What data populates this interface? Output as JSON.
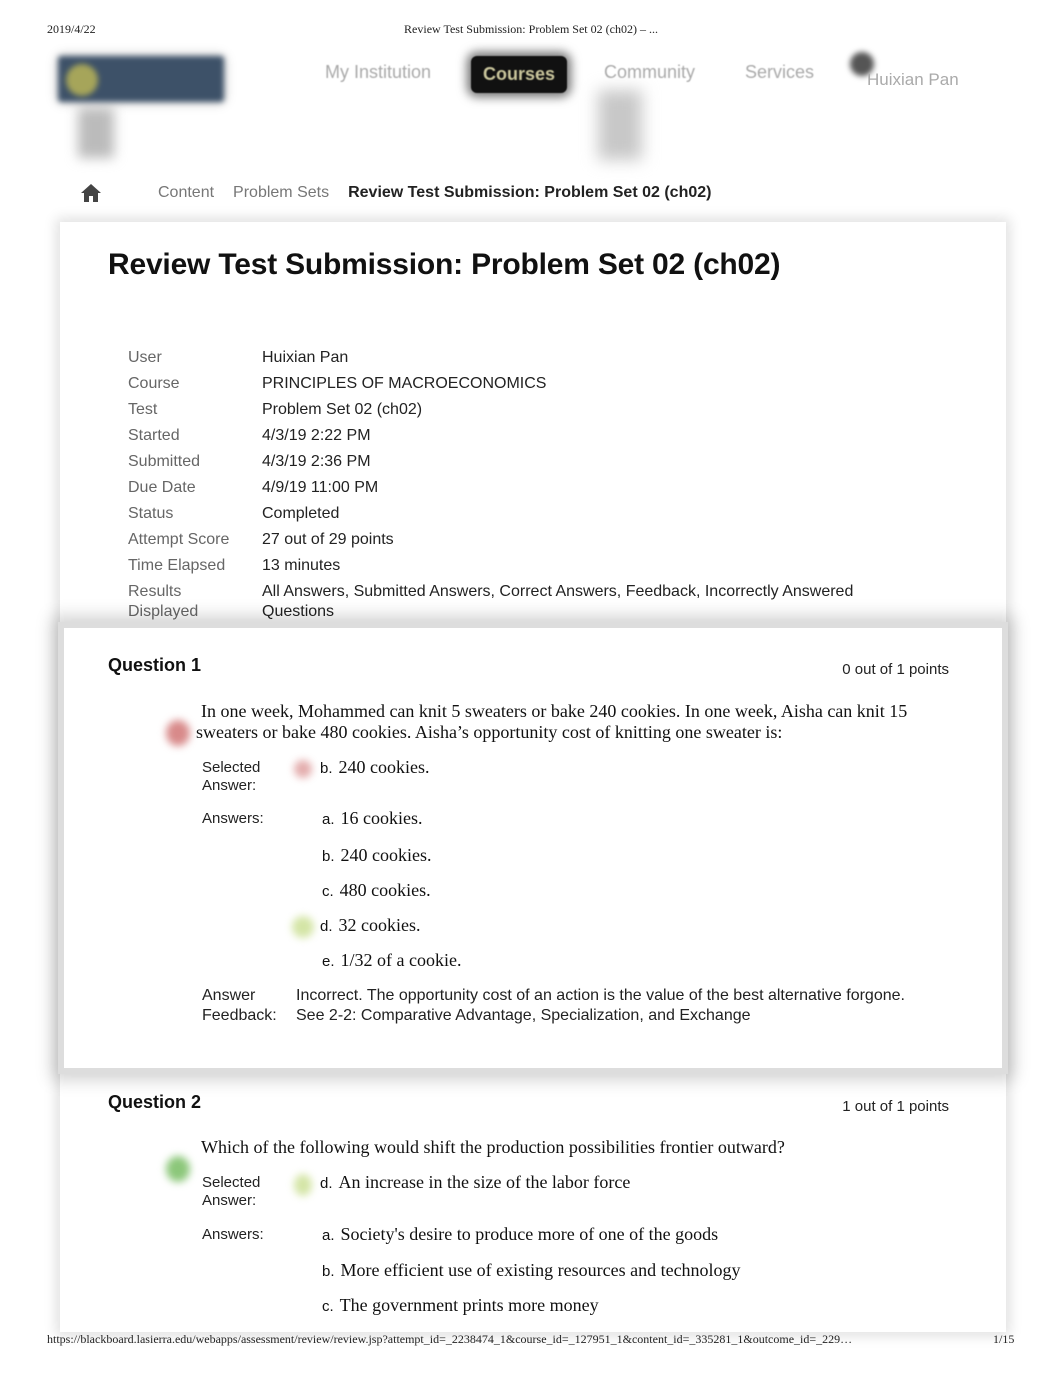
{
  "print": {
    "date": "2019/4/22",
    "title": "Review Test Submission: Problem Set 02 (ch02) – ...",
    "url": "https://blackboard.lasierra.edu/webapps/assessment/review/review.jsp?attempt_id=_2238474_1&course_id=_127951_1&content_id=_335281_1&outcome_id=_229…",
    "page": "1/15"
  },
  "nav": {
    "tabs": [
      {
        "label": "My Institution"
      },
      {
        "label": "Courses",
        "active": true
      },
      {
        "label": "Community"
      },
      {
        "label": "Services"
      }
    ],
    "user": "Huixian Pan"
  },
  "breadcrumb": {
    "home_icon": "home-icon",
    "items": [
      "Content",
      "Problem Sets",
      "Review Test Submission: Problem Set 02 (ch02)"
    ]
  },
  "page_title": "Review Test Submission: Problem Set 02 (ch02)",
  "details": [
    {
      "label": "User",
      "value": "Huixian Pan"
    },
    {
      "label": "Course",
      "value": "PRINCIPLES OF MACROECONOMICS"
    },
    {
      "label": "Test",
      "value": "Problem Set 02 (ch02)"
    },
    {
      "label": "Started",
      "value": "4/3/19 2:22 PM"
    },
    {
      "label": "Submitted",
      "value": "4/3/19 2:36 PM"
    },
    {
      "label": "Due Date",
      "value": "4/9/19 11:00 PM"
    },
    {
      "label": "Status",
      "value": "Completed"
    },
    {
      "label": "Attempt Score",
      "value": "27 out of 29 points"
    },
    {
      "label": "Time Elapsed",
      "value": "13 minutes"
    },
    {
      "label": "Results Displayed",
      "value": "All Answers, Submitted Answers, Correct Answers, Feedback, Incorrectly Answered Questions"
    }
  ],
  "labels": {
    "selected_answer": "Selected Answer:",
    "answers": "Answers:",
    "answer_feedback": "Answer Feedback:"
  },
  "questions": [
    {
      "title": "Question 1",
      "points": "0 out of 1 points",
      "status": "incorrect",
      "text": "In one week, Mohammed can knit 5 sweaters or bake 240 cookies. In one week, Aisha can knit 15 sweaters or bake 480 cookies. Aisha’s opportunity cost of knitting one sweater is:",
      "selected": {
        "letter": "b.",
        "text": "240 cookies."
      },
      "answers": [
        {
          "letter": "a.",
          "text": "16 cookies."
        },
        {
          "letter": "b.",
          "text": "240 cookies."
        },
        {
          "letter": "c.",
          "text": "480 cookies."
        },
        {
          "letter": "d.",
          "text": "32 cookies.",
          "correct": true
        },
        {
          "letter": "e.",
          "text": "1/32 of a cookie."
        }
      ],
      "feedback": "Incorrect. The opportunity cost of an action is the value of the best alternative forgone. See 2-2: Comparative Advantage, Specialization, and Exchange"
    },
    {
      "title": "Question 2",
      "points": "1 out of 1 points",
      "status": "correct",
      "text": "Which of the following would shift the production possibilities frontier outward?",
      "selected": {
        "letter": "d.",
        "text": "An increase in the size of the labor force"
      },
      "answers": [
        {
          "letter": "a.",
          "text": "Society's desire to produce more of one of the goods"
        },
        {
          "letter": "b.",
          "text": "More efficient use of existing resources and technology"
        },
        {
          "letter": "c.",
          "text": "The government prints more money"
        }
      ]
    }
  ],
  "colors": {
    "incorrect": "#d88a8a",
    "correct": "#8cc77a",
    "active_tab_bg": "#111111",
    "active_tab_text": "#c9c59c"
  }
}
